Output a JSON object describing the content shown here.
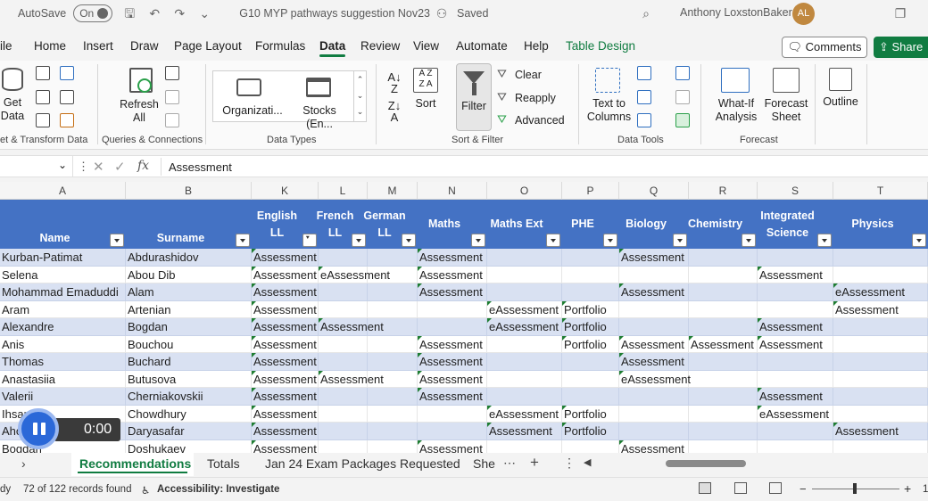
{
  "titlebar": {
    "autosave_label": "AutoSave",
    "autosave_state": "On",
    "doc_title": "G10 MYP pathways suggestion Nov23",
    "save_status": "Saved",
    "user_name": "Anthony LoxstonBaker",
    "user_initials": "AL"
  },
  "menu": {
    "items": [
      "ile",
      "Home",
      "Insert",
      "Draw",
      "Page Layout",
      "Formulas",
      "Data",
      "Review",
      "View",
      "Automate",
      "Help",
      "Table Design"
    ],
    "active": "Data",
    "comments": "Comments",
    "share": "Share"
  },
  "ribbon": {
    "get_data": "Get\nData",
    "refresh_all": "Refresh\nAll",
    "datatype_org": "Organizati...",
    "datatype_stocks": "Stocks (En...",
    "sort": "Sort",
    "filter": "Filter",
    "clear": "Clear",
    "reapply": "Reapply",
    "advanced": "Advanced",
    "text_to_columns": "Text to\nColumns",
    "what_if": "What-If\nAnalysis",
    "forecast_sheet": "Forecast\nSheet",
    "outline": "Outline",
    "groups": {
      "get_transform": "et & Transform Data",
      "queries": "Queries & Connections",
      "data_types": "Data Types",
      "sort_filter": "Sort & Filter",
      "data_tools": "Data Tools",
      "forecast": "Forecast"
    }
  },
  "formula_bar": {
    "content": "Assessment"
  },
  "grid": {
    "column_letters": [
      "A",
      "B",
      "K",
      "L",
      "M",
      "N",
      "O",
      "P",
      "Q",
      "R",
      "S",
      "T"
    ],
    "headers": [
      "Name",
      "Surname",
      "English LL",
      "French LL",
      "German LL",
      "Maths",
      "Maths Ext",
      "PHE",
      "Biology",
      "Chemistry",
      "Integrated Science",
      "Physics"
    ],
    "rows": [
      [
        "Kurban-Patimat",
        "Abdurashidov",
        "Assessment",
        "",
        "",
        "Assessment",
        "",
        "",
        "Assessment",
        "",
        "",
        ""
      ],
      [
        "Selena",
        "Abou Dib",
        "Assessment",
        "eAssessment",
        "",
        "Assessment",
        "",
        "",
        "",
        "",
        "Assessment",
        ""
      ],
      [
        "Mohammad Emaduddi",
        "Alam",
        "Assessment",
        "",
        "",
        "Assessment",
        "",
        "",
        "Assessment",
        "",
        "",
        "eAssessment"
      ],
      [
        "Aram",
        "Artenian",
        "Assessment",
        "",
        "",
        "",
        "eAssessment",
        "Portfolio",
        "",
        "",
        "",
        "Assessment"
      ],
      [
        "Alexandre",
        "Bogdan",
        "Assessment",
        "Assessment",
        "",
        "",
        "eAssessment",
        "Portfolio",
        "",
        "",
        "Assessment",
        ""
      ],
      [
        "Anis",
        "Bouchou",
        "Assessment",
        "",
        "",
        "Assessment",
        "",
        "Portfolio",
        "Assessment",
        "Assessment",
        "Assessment",
        ""
      ],
      [
        "Thomas",
        "Buchard",
        "Assessment",
        "",
        "",
        "Assessment",
        "",
        "",
        "Assessment",
        "",
        "",
        ""
      ],
      [
        "Anastasiia",
        "Butusova",
        "Assessment",
        "Assessment",
        "",
        "Assessment",
        "",
        "",
        "eAssessment",
        "",
        "",
        ""
      ],
      [
        "Valerii",
        "Cherniakovskii",
        "Assessment",
        "",
        "",
        "Assessment",
        "",
        "",
        "",
        "",
        "Assessment",
        ""
      ],
      [
        "Ihsan",
        "Chowdhury",
        "Assessment",
        "",
        "",
        "",
        "eAssessment",
        "Portfolio",
        "",
        "",
        "eAssessment",
        ""
      ],
      [
        "Ahoura",
        "Daryasafar",
        "Assessment",
        "",
        "",
        "",
        "Assessment",
        "Portfolio",
        "",
        "",
        "",
        "Assessment"
      ],
      [
        "Bogdan",
        "Doshukaev",
        "Assessment",
        "",
        "",
        "Assessment",
        "",
        "",
        "Assessment",
        "",
        "",
        ""
      ]
    ]
  },
  "recording": {
    "time": "0:00"
  },
  "sheets": {
    "tabs": [
      "Recommendations",
      "Totals",
      "Jan 24 Exam Packages Requested",
      "She"
    ],
    "active": "Recommendations"
  },
  "status": {
    "ready": "dy",
    "records": "72 of 122 records found",
    "accessibility": "Accessibility: Investigate",
    "zoom_minus": "−",
    "zoom_plus": "+",
    "zoom_level": "1"
  }
}
